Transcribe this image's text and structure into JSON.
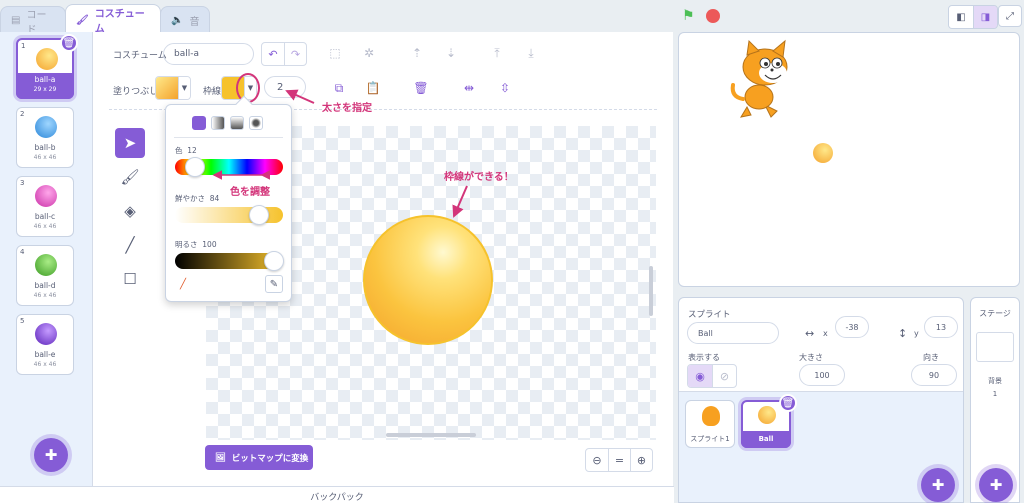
{
  "tabs": {
    "code": "コード",
    "costume": "コスチューム",
    "sound": "音"
  },
  "costumes": [
    {
      "num": "1",
      "name": "ball-a",
      "size": "29 x 29",
      "color": "#fbc43f"
    },
    {
      "num": "2",
      "name": "ball-b",
      "size": "46 x 46",
      "color": "#4aa8ee"
    },
    {
      "num": "3",
      "name": "ball-c",
      "size": "46 x 46",
      "color": "#e453c4"
    },
    {
      "num": "4",
      "name": "ball-d",
      "size": "46 x 46",
      "color": "#52b83a"
    },
    {
      "num": "5",
      "name": "ball-e",
      "size": "46 x 46",
      "color": "#7b3fd6"
    }
  ],
  "editor": {
    "costume_label": "コスチューム",
    "costume_name": "ball-a",
    "fill_label": "塗りつぶし",
    "outline_label": "枠線",
    "outline_width": "2",
    "bitmap_button": "ビットマップに変換"
  },
  "popup": {
    "color_label": "色",
    "color_value": "12",
    "saturation_label": "鮮やかさ",
    "saturation_value": "84",
    "brightness_label": "明るさ",
    "brightness_value": "100"
  },
  "annotations": {
    "thickness": "太さを指定",
    "adjust_color": "色を調整",
    "outline_made": "枠線ができる！"
  },
  "sprite": {
    "label": "スプライト",
    "name": "Ball",
    "x_label": "x",
    "x": "-38",
    "y_label": "y",
    "y": "13",
    "show_label": "表示する",
    "size_label": "大きさ",
    "size": "100",
    "direction_label": "向き",
    "direction": "90"
  },
  "sprites": [
    {
      "name": "スプライト1"
    },
    {
      "name": "Ball"
    }
  ],
  "stage_panel": {
    "title": "ステージ",
    "backdrop_label": "背景",
    "backdrop_count": "1"
  },
  "backpack": "バックパック",
  "colors": {
    "accent": "#855cd6",
    "annotation": "#d3357a"
  }
}
